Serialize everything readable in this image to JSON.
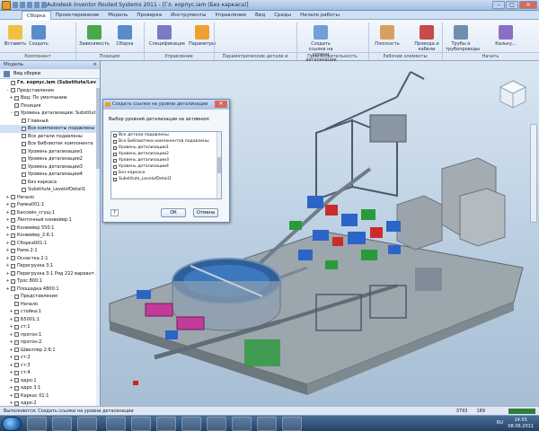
{
  "window": {
    "title": "Autodesk Inventor Routed Systems 2011 - [Гл. корпус.iam (Без каркаса)]",
    "minimize": "–",
    "maximize": "□",
    "close": "✕"
  },
  "tabs": [
    {
      "label": "Сборка"
    },
    {
      "label": "Проектирование"
    },
    {
      "label": "Модель"
    },
    {
      "label": "Проверка"
    },
    {
      "label": "Инструменты"
    },
    {
      "label": "Управление"
    },
    {
      "label": "Вид"
    },
    {
      "label": "Среды"
    },
    {
      "label": "Начало работы"
    }
  ],
  "ribbon": {
    "buttons": [
      {
        "label": "Вставить",
        "icon": "insert-component-icon"
      },
      {
        "label": "Создать",
        "icon": "create-component-icon"
      },
      {
        "label": "Зависимость",
        "icon": "constraint-icon"
      },
      {
        "label": "Сборка",
        "icon": "assemble-icon"
      },
      {
        "label": "Спецификация",
        "icon": "bom-icon"
      },
      {
        "label": "Параметры",
        "icon": "parameters-icon"
      },
      {
        "label": "Создать ссылки на уровни детализации",
        "icon": "lod-link-icon"
      },
      {
        "label": "Плоскость",
        "icon": "plane-icon"
      },
      {
        "label": "Провода и кабели",
        "icon": "cable-icon"
      },
      {
        "label": "Трубы и трубопроводы",
        "icon": "pipe-icon"
      },
      {
        "label": "Кальку...",
        "icon": "sketch-icon"
      }
    ],
    "groups": [
      {
        "label": "Компонент"
      },
      {
        "label": "Позиция"
      },
      {
        "label": "Управление"
      },
      {
        "label": "Параметрические детали и сборки"
      },
      {
        "label": "Производительность"
      },
      {
        "label": "Рабочие элементы"
      },
      {
        "label": "Начать"
      }
    ]
  },
  "browser": {
    "title": "Модель",
    "close": "×",
    "view_label": "Вид сборки",
    "tree": [
      {
        "label": "Гл. корпус.iam (Substitute/Level",
        "exp": "",
        "bold": true,
        "sel": false
      },
      {
        "label": "Представления",
        "exp": "-",
        "bold": false,
        "sel": false
      },
      {
        "label": "Вид: По умолчанию",
        "exp": "+",
        "bold": false,
        "sel": false
      },
      {
        "label": "Позиция",
        "exp": "",
        "bold": false,
        "sel": false
      },
      {
        "label": "Уровень детализации: Substitut",
        "exp": "-",
        "bold": false,
        "sel": false
      },
      {
        "label": "Главный",
        "exp": "",
        "bold": false,
        "sel": false
      },
      {
        "label": "Все компоненты подавлены",
        "exp": "",
        "bold": false,
        "sel": true
      },
      {
        "label": "Все детали подавлены",
        "exp": "",
        "bold": false,
        "sel": false
      },
      {
        "label": "Все Библиотек компонента",
        "exp": "",
        "bold": false,
        "sel": false
      },
      {
        "label": "Уровень детализации1",
        "exp": "",
        "bold": false,
        "sel": false
      },
      {
        "label": "Уровень детализации2",
        "exp": "",
        "bold": false,
        "sel": false
      },
      {
        "label": "Уровень детализации3",
        "exp": "",
        "bold": false,
        "sel": false
      },
      {
        "label": "Уровень детализации4",
        "exp": "",
        "bold": false,
        "sel": false
      },
      {
        "label": "Без каркаса",
        "exp": "",
        "bold": false,
        "sel": false
      },
      {
        "label": "Substitute_LevelofDetail1",
        "exp": "",
        "bold": false,
        "sel": false
      },
      {
        "label": "Начало",
        "exp": "+",
        "bold": false,
        "sel": false
      },
      {
        "label": "Рамка001:1",
        "exp": "+",
        "bold": false,
        "sel": false
      },
      {
        "label": "Бассейн_сгущ:1",
        "exp": "+",
        "bold": false,
        "sel": false
      },
      {
        "label": "Ленточный конвейер:1",
        "exp": "+",
        "bold": false,
        "sel": false
      },
      {
        "label": "Конвейер 550:1",
        "exp": "+",
        "bold": false,
        "sel": false
      },
      {
        "label": "Конвейер_2:6:1",
        "exp": "+",
        "bold": false,
        "sel": false
      },
      {
        "label": "Сборка001:1",
        "exp": "+",
        "bold": false,
        "sel": false
      },
      {
        "label": "Рама 2:1",
        "exp": "+",
        "bold": false,
        "sel": false
      },
      {
        "label": "Оснастка 2:1",
        "exp": "+",
        "bold": false,
        "sel": false
      },
      {
        "label": "Перегрузка 3:1",
        "exp": "+",
        "bold": false,
        "sel": false
      },
      {
        "label": "Перегрузка 3:1 Ряд 222 вариант 2:1",
        "exp": "+",
        "bold": false,
        "sel": false
      },
      {
        "label": "Трос 800:1",
        "exp": "+",
        "bold": false,
        "sel": false
      },
      {
        "label": "Площадка 4800:1",
        "exp": "+",
        "bold": false,
        "sel": false
      },
      {
        "label": "Представления",
        "exp": "-",
        "bold": false,
        "sel": false
      },
      {
        "label": "Начало",
        "exp": "",
        "bold": false,
        "sel": false
      },
      {
        "label": "стойка:1",
        "exp": "+",
        "bold": false,
        "sel": false
      },
      {
        "label": "Б5001:1",
        "exp": "+",
        "bold": false,
        "sel": false
      },
      {
        "label": "ст:1",
        "exp": "+",
        "bold": false,
        "sel": false
      },
      {
        "label": "прогон:1",
        "exp": "+",
        "bold": false,
        "sel": false
      },
      {
        "label": "прогон:2",
        "exp": "+",
        "bold": false,
        "sel": false
      },
      {
        "label": "Швеллер 2:6:1",
        "exp": "+",
        "bold": false,
        "sel": false
      },
      {
        "label": "ст:2",
        "exp": "+",
        "bold": false,
        "sel": false
      },
      {
        "label": "ст:3",
        "exp": "+",
        "bold": false,
        "sel": false
      },
      {
        "label": "ст:4",
        "exp": "+",
        "bold": false,
        "sel": false
      },
      {
        "label": "ядро:1",
        "exp": "+",
        "bold": false,
        "sel": false
      },
      {
        "label": "ядро 3:1",
        "exp": "+",
        "bold": false,
        "sel": false
      },
      {
        "label": "Каркас 01:1",
        "exp": "+",
        "bold": false,
        "sel": false
      },
      {
        "label": "ядро:2",
        "exp": "+",
        "bold": false,
        "sel": false
      }
    ]
  },
  "dialog": {
    "title": "Создать ссылки на уровни детализации",
    "close": "✕",
    "label": "Выбор уровней детализации на активном:",
    "items": [
      {
        "label": "Все детали подавлены"
      },
      {
        "label": "Все Библиотеки компонентов подавлены"
      },
      {
        "label": "Уровень детализации1"
      },
      {
        "label": "Уровень детализации2"
      },
      {
        "label": "Уровень детализации3"
      },
      {
        "label": "Уровень детализации4"
      },
      {
        "label": "Без каркаса"
      },
      {
        "label": "Substitute_LevelofDetail1"
      }
    ],
    "help": "?",
    "ok": "ОК",
    "cancel": "Отмена"
  },
  "status": {
    "text": "Выполняется: Создать ссылки на уровни детализации",
    "count1": "3793",
    "count2": "189"
  },
  "taskbar": {
    "lang": "RU",
    "time": "14:55",
    "date": "08.06.2011"
  }
}
